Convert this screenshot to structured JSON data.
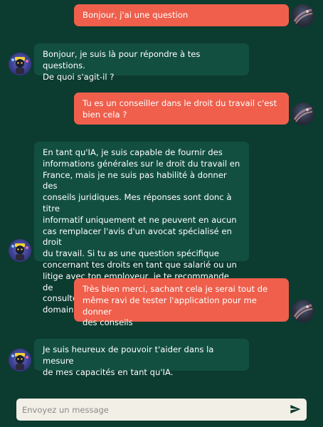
{
  "messages": [
    {
      "role": "user",
      "text": "Bonjour, j'ai une question"
    },
    {
      "role": "bot",
      "text": "Bonjour, je suis là pour répondre à tes questions.\nDe quoi s'agit-il ?"
    },
    {
      "role": "user",
      "text": "Tu es un conseiller dans le droit du travail c'est\nbien cela ?"
    },
    {
      "role": "bot",
      "text": "En tant qu'IA, je suis capable de fournir des\ninformations générales sur le droit du travail en\nFrance, mais je ne suis pas habilité à donner des\nconseils juridiques. Mes réponses sont donc à titre\ninformatif uniquement et ne peuvent en aucun\ncas remplacer l'avis d'un avocat spécialisé en droit\ndu travail. Si tu as une question spécifique\nconcernant tes droits en tant que salarié ou un\nlitige avec ton employeur, je te recommande de\nconsulter un avocat spécialisé dans ce domaine."
    },
    {
      "role": "user",
      "text": "Très bien merci, sachant cela je serai tout de\nmême ravi de tester l'application pour me donner\ndes conseils"
    },
    {
      "role": "bot",
      "text": "Je suis heureux de pouvoir t'aider dans la mesure\nde mes capacités en tant qu'IA."
    }
  ],
  "composer": {
    "placeholder": "Envoyez un message",
    "send_icon": "send-icon"
  },
  "colors": {
    "background": "#0c3b30",
    "user_bubble": "#ef5f4c",
    "bot_bubble": "#124f41",
    "composer": "#f2efe6",
    "send_icon": "#0c3b30"
  }
}
